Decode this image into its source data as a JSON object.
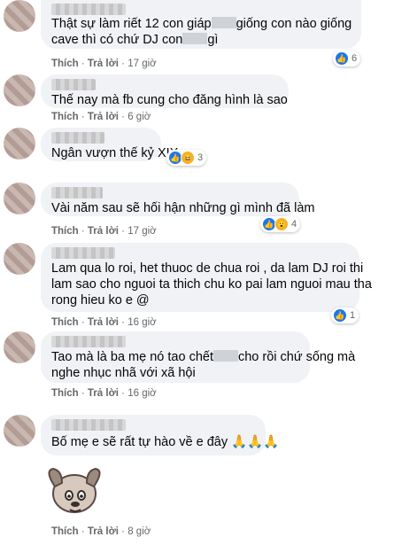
{
  "actions": {
    "like": "Thích",
    "reply": "Trả lời",
    "sep": "·"
  },
  "comments": [
    {
      "line1_pre": "Thật sự làm riết 12 con giáp",
      "line1_post": "giống con nào giống",
      "line2_pre": "cave thì có chứ DJ con",
      "line2_post": "gì",
      "time": "17 giờ",
      "reactions": [
        "like-icon"
      ],
      "reaction_count": "6"
    },
    {
      "text": "Thế nay mà fb cung cho đăng hình là sao",
      "time": "6 giờ"
    },
    {
      "text": "Ngân vượn thế kỷ XIX",
      "reactions": [
        "like-icon",
        "haha-icon"
      ],
      "reaction_count": "3"
    },
    {
      "text": "Vài năm sau sẽ hối hận những gì mình đã làm",
      "time": "17 giờ",
      "reactions": [
        "like-icon",
        "wow-icon"
      ],
      "reaction_count": "4"
    },
    {
      "line1": "Lam qua lo roi, het thuoc de chua roi , da lam DJ roi thi",
      "line2": "lam sao cho nguoi ta thich chu ko pai lam nguoi mau tha",
      "line3": "rong hieu ko e @",
      "time": "16 giờ",
      "reactions": [
        "like-icon"
      ],
      "reaction_count": "1"
    },
    {
      "line1_pre": "Tao mà là ba mẹ nó tao chết",
      "line1_post": "cho rồi chứ sống mà",
      "line2": "nghe nhục nhã với xã hội",
      "time": "16 giờ"
    },
    {
      "text": "Bố mẹ e sẽ rất tự hào về e đây 🙏🙏🙏",
      "time": "8 giờ",
      "sticker": "dog-sticker"
    }
  ],
  "colors": {
    "bubble": "#f0f2f5",
    "meta": "#65676b",
    "like": "#1877f2"
  }
}
